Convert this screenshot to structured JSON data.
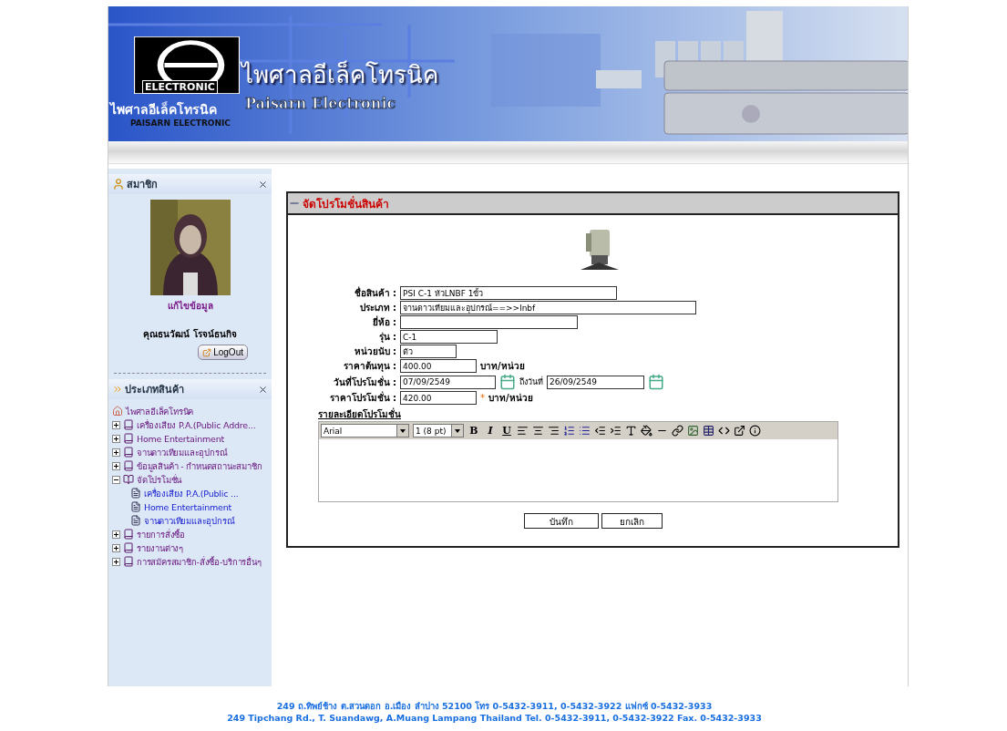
{
  "header": {
    "logo_badge": "ELECTRONIC",
    "title_thai": "ไพศาลอีเล็คโทรนิค",
    "title_english": "Paisarn Electronic",
    "logo_thai": "ไพศาลอีเล็คโทรนิค",
    "logo_english": "PAISARN ELECTRONIC"
  },
  "member_box": {
    "title": "สมาชิก",
    "edit_link": "แก้ไขข้อมูล",
    "user_name": "คุณธนวัฒน์ โรจน์ธนกิจ",
    "logout": "LogOut"
  },
  "category_box": {
    "title": "ประเภทสินค้า",
    "tree": [
      {
        "label": "ไพศาลอีเล็คโทรนิค",
        "kind": "home",
        "children": [
          {
            "label": "เครื่องเสียง P.A.(Public Addre...",
            "kind": "folder",
            "expanded": false
          },
          {
            "label": "Home Entertainment",
            "kind": "folder",
            "expanded": false
          },
          {
            "label": "จานดาวเทียมและอุปกรณ์",
            "kind": "folder",
            "expanded": false
          },
          {
            "label": "ข้อมูลสินค้า - กำหนดสถานะสมาชิก",
            "kind": "folder",
            "expanded": false
          },
          {
            "label": "จัดโปรโมชั่น",
            "kind": "folder",
            "expanded": true,
            "children": [
              {
                "label": "เครื่องเสียง P.A.(Public ...",
                "kind": "page"
              },
              {
                "label": "Home Entertainment",
                "kind": "page"
              },
              {
                "label": "จานดาวเทียมและอุปกรณ์",
                "kind": "page"
              }
            ]
          },
          {
            "label": "รายการสั่งซื้อ",
            "kind": "folder",
            "expanded": false
          },
          {
            "label": "รายงานต่างๆ",
            "kind": "folder",
            "expanded": false
          },
          {
            "label": "การสมัครสมาชิก-สั่งซื้อ-บริการอื่นๆ",
            "kind": "folder",
            "expanded": false
          }
        ]
      }
    ]
  },
  "panel": {
    "title": "จัดโปรโมชั่นสินค้า",
    "fields": [
      {
        "label": "ชื่อสินค้า :",
        "value": "PSI C-1 หัวLNBF 1ขั้ว",
        "kind": "text"
      },
      {
        "label": "ประเภท :",
        "value": "จานดาวเทียมและอุปกรณ์==>>lnbf",
        "kind": "text"
      },
      {
        "label": "ยี่ห้อ :",
        "kind": "text"
      },
      {
        "label": "รุ่น :",
        "value": "C-1",
        "kind": "text"
      },
      {
        "label": "หน่วยนับ :",
        "value": "ตัว",
        "kind": "text"
      },
      {
        "label": "ราคาต้นทุน :",
        "value": "400.00",
        "kind": "price",
        "unit": "บาท/หน่วย"
      },
      {
        "label": "วันที่โปรโมชั่น :",
        "value": "07/09/2549",
        "kind": "daterange",
        "to_label": "ถึงวันที่",
        "to_value": "26/09/2549"
      },
      {
        "label": "ราคาโปรโมชั่น :",
        "value": "420.00",
        "kind": "price",
        "unit": "บาท/หน่วย",
        "required": true,
        "required_mark": "*"
      }
    ],
    "details_label": "รายละเอียดโปรโมชั่น",
    "editor": {
      "font": "Arial",
      "size": "1 (8 pt)",
      "bold": "B",
      "italic": "I",
      "underline": "U"
    },
    "buttons": [
      "บันทึก",
      "ยกเลิก"
    ]
  },
  "footer": [
    "249 ถ.ทิพย์ช้าง ต.สวนดอก อ.เมือง ลำปาง 52100 โทร 0-5432-3911, 0-5432-3922 แฟกซ์ 0-5432-3933",
    "249 Tipchang Rd., T. Suandawg, A.Muang Lampang Thailand Tel. 0-5432-3911, 0-5432-3922 Fax. 0-5432-3933"
  ]
}
